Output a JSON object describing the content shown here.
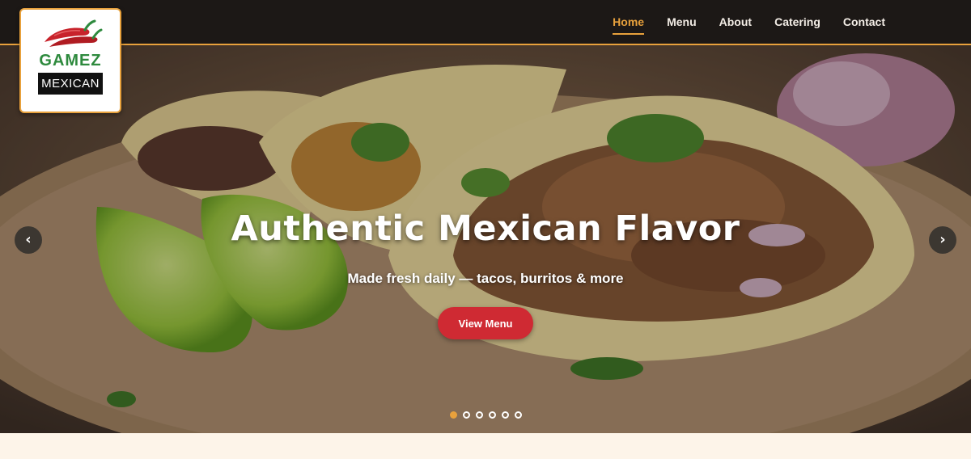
{
  "brand": {
    "name": "GAMEZ",
    "tagline": "MEXICAN",
    "logo_icon": "chili-peppers-icon",
    "name_color": "#2e8a3e",
    "accent_color": "#e8a13c"
  },
  "nav": {
    "items": [
      {
        "label": "Home",
        "active": true
      },
      {
        "label": "Menu",
        "active": false
      },
      {
        "label": "About",
        "active": false
      },
      {
        "label": "Catering",
        "active": false
      },
      {
        "label": "Contact",
        "active": false
      }
    ]
  },
  "hero": {
    "title": "Authentic Mexican Flavor",
    "subtitle": "Made fresh daily — tacos, burritos & more",
    "cta_label": "View Menu",
    "cta_color": "#cf2a33",
    "prev_label": "‹",
    "next_label": "›",
    "slides_total": 6,
    "active_slide": 1
  }
}
